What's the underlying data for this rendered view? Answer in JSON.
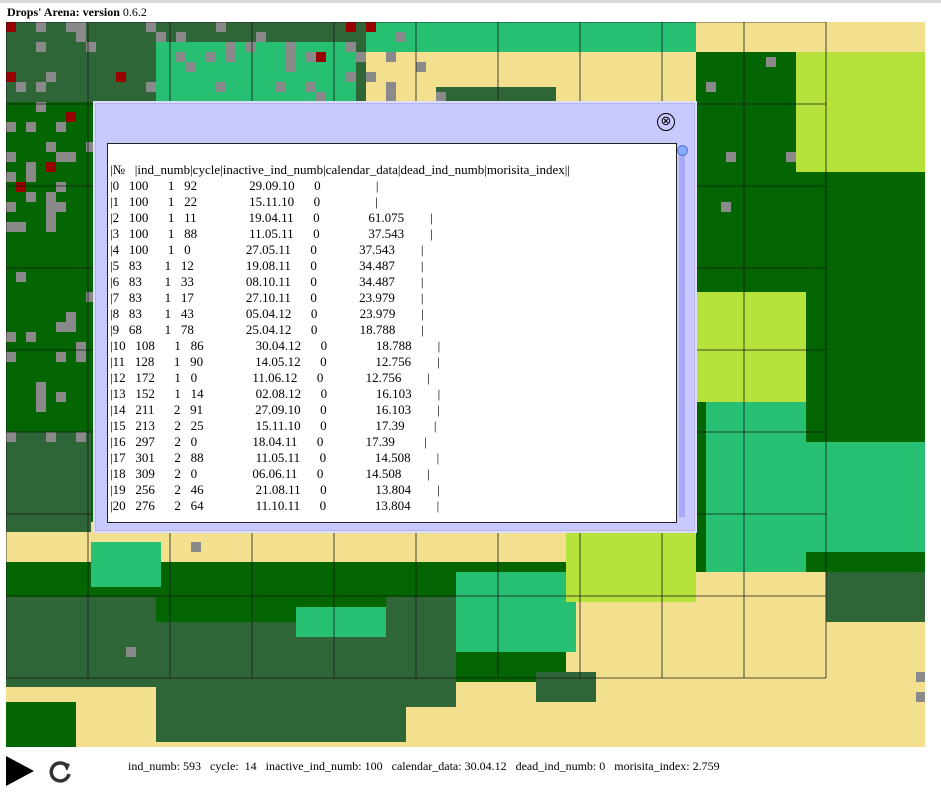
{
  "app": {
    "title_bold": "Drops' Arena: version",
    "version": " 0.6.2"
  },
  "colors": {
    "dark_green": "#036603",
    "mid_dark": "#2e6637",
    "light_green": "#27c072",
    "yellow_green": "#b5e33c",
    "sand": "#f3e08e",
    "gray": "#8a8a8a",
    "red": "#990000",
    "grid": "#1a1a1a",
    "dialog_bg": "#c9c9ff"
  },
  "dialog": {
    "close_icon": "⊗",
    "header": "|№   |ind_numb|cycle|inactive_ind_numb|calendar_data|dead_ind_numb|morisita_index||",
    "rows": [
      "|0   100      1   92                29.09.10      0                 |",
      "|1   100      1   22                15.11.10      0                 |",
      "|2   100      1   11                19.04.11      0               61.075        |",
      "|3   100      1   88                11.05.11      0               37.543        |",
      "|4   100      1   0                 27.05.11      0             37.543        |",
      "|5   83       1   12                19.08.11      0             34.487        |",
      "|6   83       1   33                08.10.11      0             34.487        |",
      "|7   83       1   17                27.10.11      0             23.979        |",
      "|8   83       1   43                05.04.12      0             23.979        |",
      "|9   68       1   78                25.04.12      0             18.788        |",
      "|10   108      1   86                30.04.12      0               18.788        |",
      "|11   128      1   90                14.05.12      0               12.756        |",
      "|12   172      1   0                 11.06.12      0             12.756        |",
      "|13   152      1   14                02.08.12      0               16.103        |",
      "|14   211      2   91                27.09.10      0               16.103        |",
      "|15   213      2   25                15.11.10      0               17.39         |",
      "|16   297      2   0                 18.04.11      0             17.39         |",
      "|17   301      2   88                11.05.11      0               14.508        |",
      "|18   309      2   0                 06.06.11      0             14.508        |",
      "|19   256      2   46                21.08.11      0               13.804        |",
      "|20   276      2   64                11.10.11      0               13.804        |"
    ]
  },
  "status": {
    "text": "ind_numb: 593   cycle:  14   inactive_ind_numb: 100   calendar_data: 30.04.12   dead_ind_numb: 0   morisita_index: 2.759"
  },
  "icons": {
    "play": "play-icon",
    "reload": "reload-icon",
    "close": "close-circle-icon"
  }
}
